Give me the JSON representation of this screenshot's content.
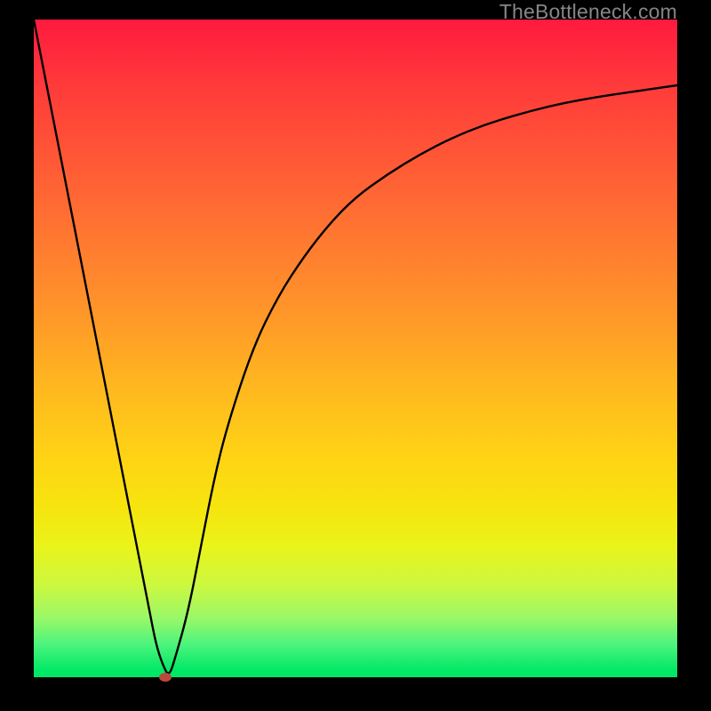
{
  "watermark": "TheBottleneck.com",
  "colors": {
    "background": "#000000",
    "curve": "#000000",
    "dot": "#b94a3c"
  },
  "chart_data": {
    "type": "line",
    "title": "",
    "xlabel": "",
    "ylabel": "",
    "xlim": [
      0,
      100
    ],
    "ylim": [
      0,
      100
    ],
    "grid": false,
    "series": [
      {
        "name": "bottleneck-curve",
        "x": [
          0,
          2,
          4,
          6,
          8,
          10,
          12,
          14,
          16,
          18,
          19,
          20,
          21,
          22,
          24,
          26,
          28,
          30,
          34,
          38,
          42,
          46,
          50,
          55,
          60,
          65,
          70,
          75,
          80,
          85,
          90,
          95,
          100
        ],
        "values": [
          100,
          90,
          80,
          70,
          60,
          50,
          40,
          30,
          20,
          10,
          5,
          2,
          0,
          3,
          10,
          20,
          30,
          38,
          50,
          58,
          64,
          69,
          73,
          76.5,
          79.5,
          82,
          84,
          85.5,
          86.8,
          87.8,
          88.6,
          89.3,
          90
        ]
      }
    ],
    "annotations": [
      {
        "type": "dot",
        "x": 20.5,
        "y": 0
      }
    ],
    "background_gradient": {
      "direction": "vertical",
      "stops": [
        {
          "pos": 0,
          "color": "#ff1a3f"
        },
        {
          "pos": 50,
          "color": "#ff9a28"
        },
        {
          "pos": 80,
          "color": "#eaf31a"
        },
        {
          "pos": 100,
          "color": "#00e865"
        }
      ]
    }
  }
}
